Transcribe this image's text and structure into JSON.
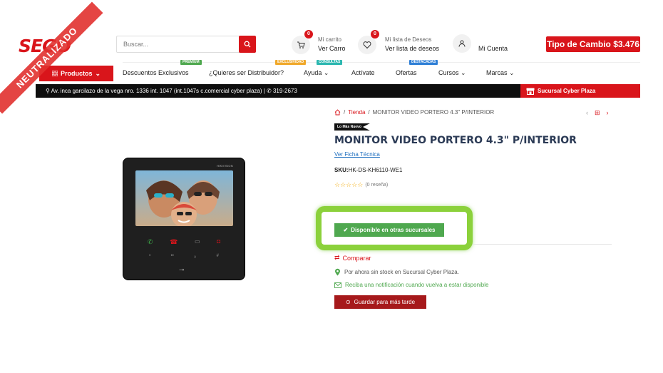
{
  "header": {
    "logo_text": "SEGO",
    "ribbon_text": "NEUTRALIZADO",
    "search_placeholder": "Buscar...",
    "cart": {
      "badge": "0",
      "line1": "Mi carrito",
      "line2": "Ver Carro"
    },
    "wishlist": {
      "badge": "0",
      "line1": "Mi lista de Deseos",
      "line2": "Ver lista de deseos"
    },
    "account": {
      "label": "Mi Cuenta"
    },
    "exchange_rate": "Tipo de Cambio $3.476"
  },
  "nav": {
    "products": "Productos",
    "items": [
      {
        "label": "Descuentos Exclusivos",
        "tag": "PREMIUM",
        "tag_color": "#4fa84f"
      },
      {
        "label": "¿Quieres ser Distribuidor?",
        "tag": "EXCLUSIVIDAD",
        "tag_color": "#f0a82a"
      },
      {
        "label": "Ayuda",
        "tag": "CONSULTAS",
        "tag_color": "#2bb7b0"
      },
      {
        "label": "Actívate",
        "tag": "",
        "tag_color": ""
      },
      {
        "label": "Ofertas",
        "tag": "DESTACADAS",
        "tag_color": "#2f7fd6"
      },
      {
        "label": "Cursos",
        "tag": "",
        "tag_color": ""
      },
      {
        "label": "Marcas",
        "tag": "",
        "tag_color": ""
      }
    ]
  },
  "address_bar": {
    "address": "Av. inca garcilazo de la vega nro. 1336 int. 1047 (int.1047s c.comercial cyber plaza) |",
    "phone": "319-2673",
    "branch": "Sucursal Cyber Plaza"
  },
  "product": {
    "device_brand": "HIKVISION",
    "breadcrumb": {
      "store": "Tienda",
      "current": "MONITOR VIDEO PORTERO 4.3\" P/INTERIOR"
    },
    "badge": "Lo Más Nuevo",
    "title": "MONITOR VIDEO PORTERO 4.3\" P/INTERIOR",
    "spec_link": "Ver Ficha Técnica",
    "sku_label": "SKU:",
    "sku_value": "HK-DS-KH6110-WE1",
    "rating": 0,
    "reviews": "(0 reseña)",
    "availability": "Disponible en otras sucursales",
    "compare": "Comparar",
    "no_stock": "Por ahora sin stock en Sucursal Cyber Plaza.",
    "notify": "Reciba una notificación cuando vuelva a estar disponible",
    "save_later": "Guardar para más tarde"
  },
  "colors": {
    "brand_red": "#d9151b",
    "green": "#4fa84f",
    "highlight": "#8bd13b",
    "title_navy": "#2b3a55"
  }
}
